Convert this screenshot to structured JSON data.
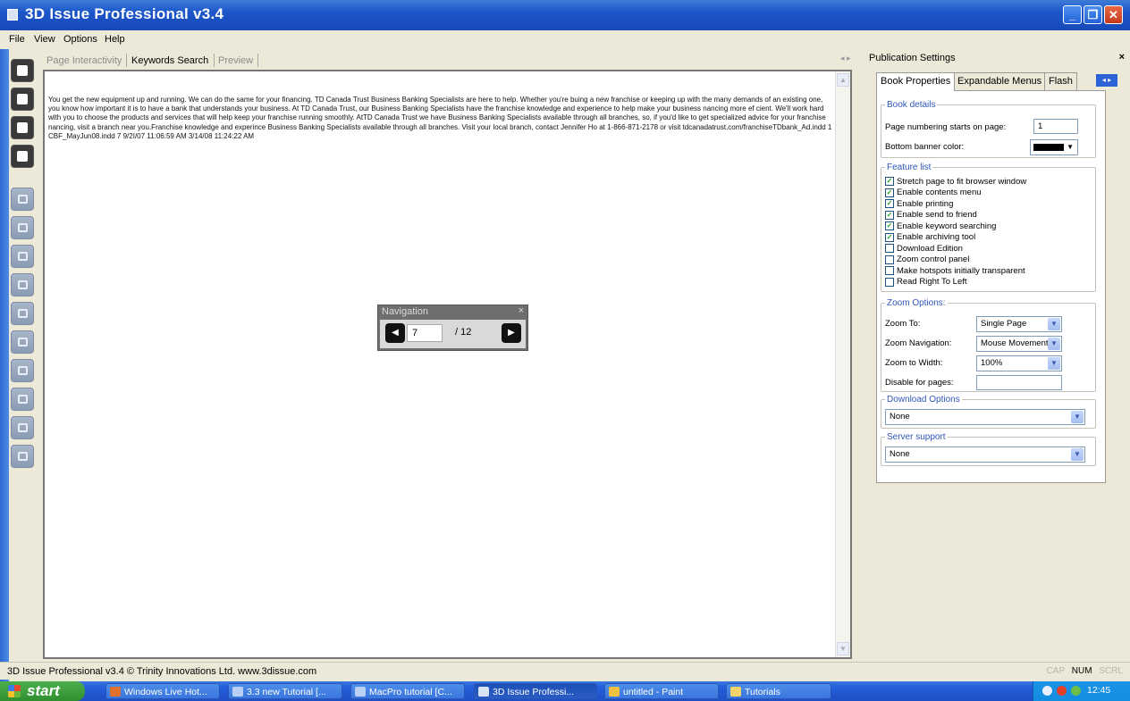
{
  "app": {
    "title": "3D Issue Professional v3.4"
  },
  "menu": [
    "File",
    "View",
    "Options",
    "Help"
  ],
  "center_tabs": [
    {
      "label": "Page Interactivity",
      "active": false
    },
    {
      "label": "Keywords Search",
      "active": true
    },
    {
      "label": "Preview",
      "active": false
    }
  ],
  "document": {
    "text": "You get the new equipment up and running. We can do the same for your financing. TD Canada Trust Business Banking Specialists are here to help. Whether you're buing a new franchise or keeping up with the many demands of an existing one, you know how important it is to have a bank that understands your business. At TD Canada Trust, our Business Banking Specialists have the franchise knowledge and experience to help make your business nancing more ef cient. We'll work hard with you to choose the products and services that will help keep your franchise running smoothly. AtTD Canada Trust we have Business Banking Specialists available through all branches, so, if you'd like to get specialized advice for your franchise nancing, visit a branch near you.Franchise knowledge and experince Business Banking Specialists available through all branches. Visit your local branch, contact Jennifer Ho at 1-866-871-2178 or visit tdcanadatrust.com/franchiseTDbank_Ad.indd 1 CBF_MayJun08.indd 7 9/2I/07 11:06:59 AM 3/14/08 11:24:22 AM"
  },
  "navigation": {
    "title": "Navigation",
    "close": "×",
    "current_page": "7",
    "total": "/ 12"
  },
  "publication_settings": {
    "title": "Publication Settings",
    "close": "×",
    "tabs": [
      "Book Properties",
      "Expandable Menus",
      "Flash"
    ],
    "book_details": {
      "legend": "Book details",
      "page_numbering_label": "Page numbering starts on page:",
      "page_numbering_value": "1",
      "banner_color_label": "Bottom banner color:",
      "banner_color": "#000000"
    },
    "feature_list": {
      "legend": "Feature list",
      "items": [
        {
          "label": "Stretch page to fit browser window",
          "checked": true
        },
        {
          "label": "Enable contents menu",
          "checked": true
        },
        {
          "label": "Enable printing",
          "checked": true
        },
        {
          "label": "Enable send to friend",
          "checked": true
        },
        {
          "label": "Enable keyword searching",
          "checked": true
        },
        {
          "label": "Enable archiving tool",
          "checked": true
        },
        {
          "label": "Download Edition",
          "checked": false
        },
        {
          "label": "Zoom control panel",
          "checked": false
        },
        {
          "label": "Make hotspots initially transparent",
          "checked": false
        },
        {
          "label": "Read Right To Left",
          "checked": false
        }
      ]
    },
    "zoom_options": {
      "legend": "Zoom Options:",
      "zoom_to_label": "Zoom To:",
      "zoom_to_value": "Single Page",
      "zoom_nav_label": "Zoom Navigation:",
      "zoom_nav_value": "Mouse Movement",
      "zoom_width_label": "Zoom to Width:",
      "zoom_width_value": "100%",
      "disable_label": "Disable for pages:",
      "disable_value": ""
    },
    "download_options": {
      "legend": "Download Options",
      "value": "None"
    },
    "server_support": {
      "legend": "Server support",
      "value": "None"
    }
  },
  "status": {
    "text": "3D Issue Professional v3.4 © Trinity Innovations Ltd. www.3dissue.com",
    "keys": [
      "CAP",
      "NUM",
      "SCRL"
    ]
  },
  "taskbar": {
    "start": "start",
    "tasks": [
      {
        "label": "Windows Live Hot...",
        "active": false
      },
      {
        "label": "3.3 new Tutorial [...",
        "active": false
      },
      {
        "label": "MacPro tutorial [C...",
        "active": false
      },
      {
        "label": "3D Issue Professi...",
        "active": true
      },
      {
        "label": "untitled - Paint",
        "active": false
      },
      {
        "label": "Tutorials",
        "active": false
      }
    ],
    "clock": "12:45"
  }
}
